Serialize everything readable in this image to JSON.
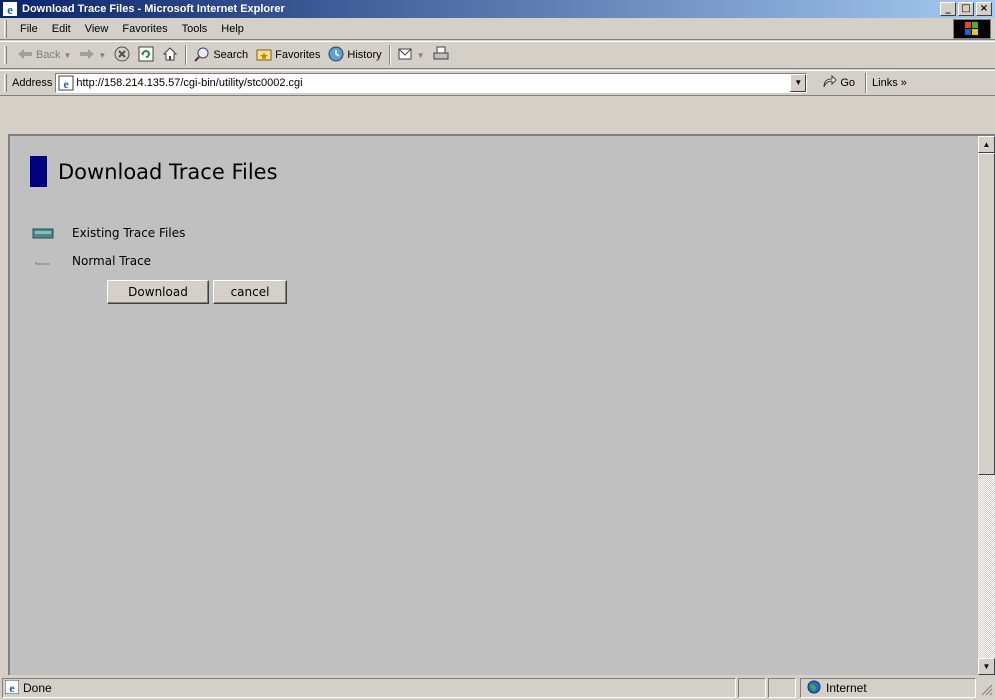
{
  "window": {
    "title": "Download Trace Files - Microsoft Internet Explorer",
    "buttons": [
      "_",
      "□",
      "×"
    ]
  },
  "menu": [
    "File",
    "Edit",
    "View",
    "Favorites",
    "Tools",
    "Help"
  ],
  "toolbar": {
    "back": "Back",
    "search": "Search",
    "favorites": "Favorites",
    "history": "History"
  },
  "address": {
    "label": "Address",
    "url": "http://158.214.135.57/cgi-bin/utility/stc0002.cgi",
    "go": "Go",
    "links": "Links"
  },
  "page": {
    "heading": "Download Trace Files",
    "existing_label": "Existing Trace Files",
    "normal_label": "Normal Trace",
    "download_button": "Download",
    "cancel_button": "cancel"
  },
  "status": {
    "text": "Done",
    "zone": "Internet"
  },
  "colors": {
    "accent": "#000080",
    "title_start": "#0a246a",
    "title_end": "#a6caf0"
  }
}
